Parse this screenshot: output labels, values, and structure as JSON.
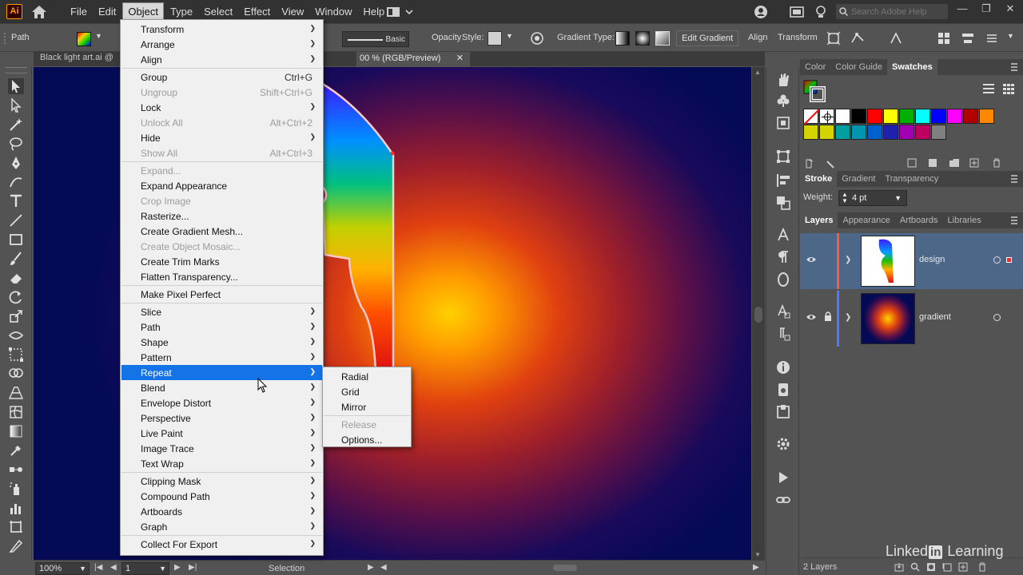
{
  "app": {
    "logo_text": "Ai",
    "menus": [
      "File",
      "Edit",
      "Object",
      "Type",
      "Select",
      "Effect",
      "View",
      "Window",
      "Help"
    ],
    "active_menu": "Object",
    "search_placeholder": "Search Adobe Help"
  },
  "control_bar": {
    "selection_type": "Path",
    "stroke_style": "Basic",
    "opacity_label": "Opacity",
    "style_label": "Style:",
    "gradient_type_label": "Gradient Type:",
    "edit_gradient_button": "Edit Gradient",
    "align_button": "Align",
    "transform_button": "Transform"
  },
  "document": {
    "tab1": "Black light art.ai @",
    "tab2": "00 % (RGB/Preview)"
  },
  "object_menu": {
    "items": [
      {
        "label": "Transform",
        "shortcut": "",
        "submenu": true,
        "disabled": false
      },
      {
        "label": "Arrange",
        "shortcut": "",
        "submenu": true,
        "disabled": false
      },
      {
        "label": "Align",
        "shortcut": "",
        "submenu": true,
        "disabled": false
      },
      {
        "label": "Group",
        "shortcut": "Ctrl+G",
        "submenu": false,
        "disabled": false
      },
      {
        "label": "Ungroup",
        "shortcut": "Shift+Ctrl+G",
        "submenu": false,
        "disabled": true
      },
      {
        "label": "Lock",
        "shortcut": "",
        "submenu": true,
        "disabled": false
      },
      {
        "label": "Unlock All",
        "shortcut": "Alt+Ctrl+2",
        "submenu": false,
        "disabled": true
      },
      {
        "label": "Hide",
        "shortcut": "",
        "submenu": true,
        "disabled": false
      },
      {
        "label": "Show All",
        "shortcut": "Alt+Ctrl+3",
        "submenu": false,
        "disabled": true
      },
      {
        "label": "Expand...",
        "shortcut": "",
        "submenu": false,
        "disabled": true
      },
      {
        "label": "Expand Appearance",
        "shortcut": "",
        "submenu": false,
        "disabled": false
      },
      {
        "label": "Crop Image",
        "shortcut": "",
        "submenu": false,
        "disabled": true
      },
      {
        "label": "Rasterize...",
        "shortcut": "",
        "submenu": false,
        "disabled": false
      },
      {
        "label": "Create Gradient Mesh...",
        "shortcut": "",
        "submenu": false,
        "disabled": false
      },
      {
        "label": "Create Object Mosaic...",
        "shortcut": "",
        "submenu": false,
        "disabled": true
      },
      {
        "label": "Create Trim Marks",
        "shortcut": "",
        "submenu": false,
        "disabled": false
      },
      {
        "label": "Flatten Transparency...",
        "shortcut": "",
        "submenu": false,
        "disabled": false
      },
      {
        "label": "Make Pixel Perfect",
        "shortcut": "",
        "submenu": false,
        "disabled": false
      },
      {
        "label": "Slice",
        "shortcut": "",
        "submenu": true,
        "disabled": false
      },
      {
        "label": "Path",
        "shortcut": "",
        "submenu": true,
        "disabled": false
      },
      {
        "label": "Shape",
        "shortcut": "",
        "submenu": true,
        "disabled": false
      },
      {
        "label": "Pattern",
        "shortcut": "",
        "submenu": true,
        "disabled": false
      },
      {
        "label": "Repeat",
        "shortcut": "",
        "submenu": true,
        "disabled": false,
        "highlighted": true
      },
      {
        "label": "Blend",
        "shortcut": "",
        "submenu": true,
        "disabled": false
      },
      {
        "label": "Envelope Distort",
        "shortcut": "",
        "submenu": true,
        "disabled": false
      },
      {
        "label": "Perspective",
        "shortcut": "",
        "submenu": true,
        "disabled": false
      },
      {
        "label": "Live Paint",
        "shortcut": "",
        "submenu": true,
        "disabled": false
      },
      {
        "label": "Image Trace",
        "shortcut": "",
        "submenu": true,
        "disabled": false
      },
      {
        "label": "Text Wrap",
        "shortcut": "",
        "submenu": true,
        "disabled": false
      },
      {
        "label": "Clipping Mask",
        "shortcut": "",
        "submenu": true,
        "disabled": false
      },
      {
        "label": "Compound Path",
        "shortcut": "",
        "submenu": true,
        "disabled": false
      },
      {
        "label": "Artboards",
        "shortcut": "",
        "submenu": true,
        "disabled": false
      },
      {
        "label": "Graph",
        "shortcut": "",
        "submenu": true,
        "disabled": false
      },
      {
        "label": "Collect For Export",
        "shortcut": "",
        "submenu": true,
        "disabled": false
      }
    ]
  },
  "repeat_submenu": {
    "items": [
      {
        "label": "Radial",
        "disabled": false
      },
      {
        "label": "Grid",
        "disabled": false
      },
      {
        "label": "Mirror",
        "disabled": false
      },
      {
        "label": "Release",
        "disabled": true
      },
      {
        "label": "Options...",
        "disabled": false
      }
    ]
  },
  "swatches_panel": {
    "tabs": [
      "Color",
      "Color Guide",
      "Swatches"
    ],
    "active_tab": "Swatches",
    "row1_colors": [
      "#ffffff",
      "#000000",
      "#ff0000",
      "#ffff00",
      "#00b000",
      "#00ffff",
      "#0000ff",
      "#ff00ff",
      "#b00000",
      "#ff8800"
    ],
    "row2_colors": [
      "#d4d400",
      "#009f9f",
      "#0096b0",
      "#0060d0",
      "#2020b0",
      "#a000b0",
      "#c00060",
      "#808080"
    ]
  },
  "stroke_panel": {
    "tabs": [
      "Stroke",
      "Gradient",
      "Transparency"
    ],
    "active_tab": "Stroke",
    "weight_label": "Weight:",
    "weight_value": "4 pt"
  },
  "layers_panel": {
    "tabs": [
      "Layers",
      "Appearance",
      "Artboards",
      "Libraries"
    ],
    "active_tab": "Layers",
    "layers": [
      {
        "name": "design",
        "color": "#ff5a3c",
        "selected": true,
        "locked": false
      },
      {
        "name": "gradient",
        "color": "#4a7cff",
        "selected": false,
        "locked": true
      }
    ],
    "count_text": "2 Layers"
  },
  "status_bar": {
    "zoom": "100%",
    "artboard": "1",
    "tool": "Selection"
  },
  "watermark": {
    "text1": "Linked",
    "text2": "in",
    "text3": " Learning"
  }
}
